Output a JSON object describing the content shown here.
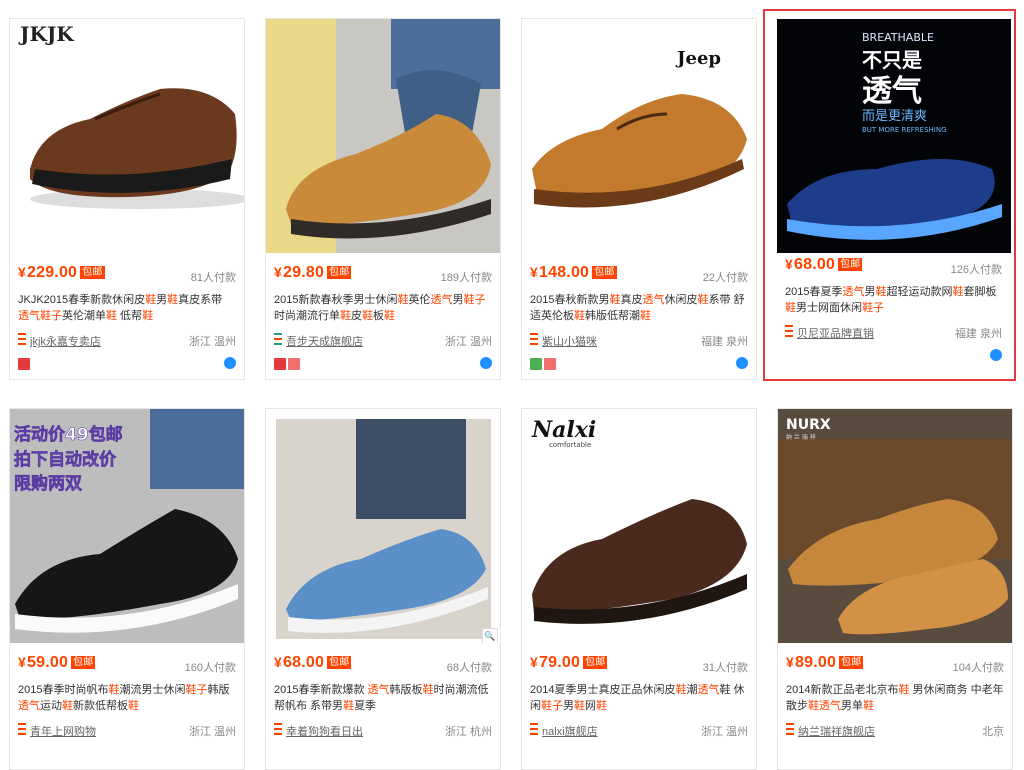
{
  "products": [
    {
      "price": "229.00",
      "badge": "包邮",
      "deals": "81人付款",
      "title_parts": [
        "JKJK2015春季新款休闲皮",
        "鞋",
        "男",
        "鞋",
        "真皮系带 ",
        "透气",
        "鞋子",
        "英伦潮单",
        "鞋",
        " 低帮",
        "鞋"
      ],
      "shop": "jkjk永嘉专卖店",
      "location": "浙江 温州",
      "brand_text": "JKJK"
    },
    {
      "price": "29.80",
      "badge": "包邮",
      "deals": "189人付款",
      "title_parts": [
        "2015新款春秋季男士休闲",
        "鞋",
        "英伦",
        "透气",
        "男",
        "鞋子",
        "时尚潮流行单",
        "鞋",
        "皮",
        "鞋",
        "板",
        "鞋"
      ],
      "shop": "吾步天成旗舰店",
      "location": "浙江 温州",
      "brand_text": ""
    },
    {
      "price": "148.00",
      "badge": "包邮",
      "deals": "22人付款",
      "title_parts": [
        "2015春秋新款男",
        "鞋",
        "真皮",
        "透气",
        "休闲皮",
        "鞋",
        "系带 舒适英伦板",
        "鞋",
        "韩版低帮潮",
        "鞋"
      ],
      "shop": "紫山小猫咪",
      "location": "福建 泉州",
      "brand_text": "Jeep"
    },
    {
      "price": "68.00",
      "badge": "包邮",
      "deals": "126人付款",
      "title_parts": [
        "2015春夏季",
        "透气",
        "男",
        "鞋",
        "超轻运动款网",
        "鞋",
        "套脚板",
        "鞋",
        "男士网面休闲",
        "鞋子"
      ],
      "shop": "贝尼亚品牌直销",
      "location": "福建 泉州",
      "brand_text": "BREATHABLE",
      "promo_line1": "不只是",
      "promo_line2": "透气",
      "promo_line3": "而是更清爽",
      "promo_line4": "BUT MORE REFRESHING"
    },
    {
      "price": "59.00",
      "badge": "包邮",
      "deals": "160人付款",
      "title_parts": [
        "2015春季时尚帆布",
        "鞋",
        "潮流男士休闲",
        "鞋子",
        "韩版",
        "透气",
        "运动",
        "鞋",
        "新款低帮板",
        "鞋"
      ],
      "shop": "青年上网购物",
      "location": "浙江 温州",
      "promo_line1": "活动价49包邮",
      "promo_line2": "拍下自动改价",
      "promo_line3": "限购两双"
    },
    {
      "price": "68.00",
      "badge": "包邮",
      "deals": "68人付款",
      "title_parts": [
        "2015春季新款爆款 ",
        "透气",
        "韩版板",
        "鞋",
        "时尚潮流低帮帆布 系带男",
        "鞋",
        "夏季"
      ],
      "shop": "幸着狗狗看日出",
      "location": "浙江 杭州",
      "brand_text": ""
    },
    {
      "price": "79.00",
      "badge": "包邮",
      "deals": "31人付款",
      "title_parts": [
        "2014夏季男士真皮正品休闲皮",
        "鞋",
        "潮",
        "透气",
        "鞋 休闲",
        "鞋子",
        "男",
        "鞋",
        "网",
        "鞋"
      ],
      "shop": "nalxi旗舰店",
      "location": "浙江 温州",
      "brand_text": "Nalxi",
      "brand_sub": "comfortable"
    },
    {
      "price": "89.00",
      "badge": "包邮",
      "deals": "104人付款",
      "title_parts": [
        "2014新款正品老北京布",
        "鞋",
        " 男休闲商务 中老年散步",
        "鞋",
        "透气",
        "男单",
        "鞋"
      ],
      "shop": "纳兰瑞祥旗舰店",
      "location": "北京",
      "brand_text": "NURX",
      "brand_sub": "纳 兰 瑞 祥"
    }
  ],
  "currency": "¥",
  "colors": {
    "accent": "#ff4400",
    "selected_border": "#e4393c"
  }
}
